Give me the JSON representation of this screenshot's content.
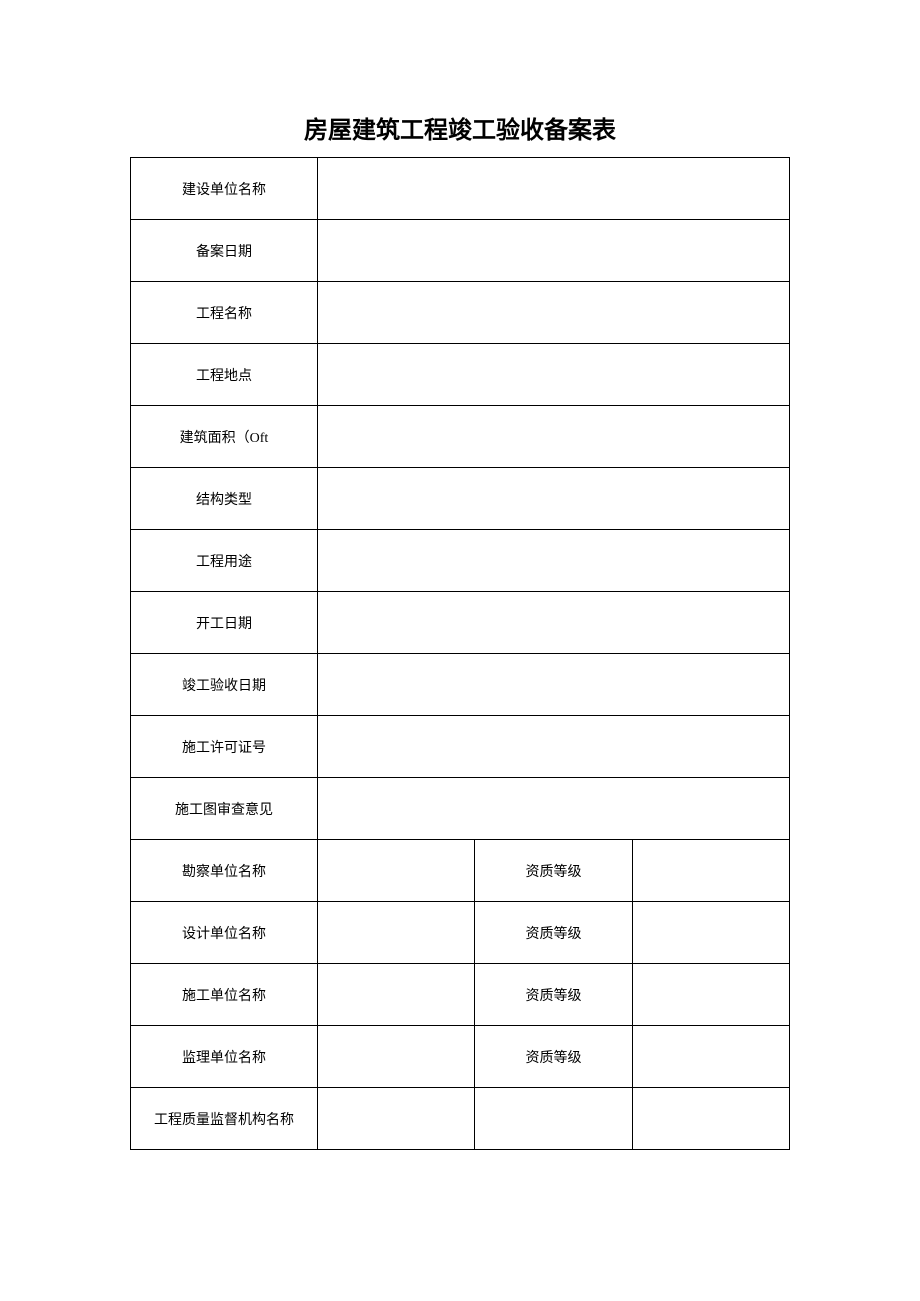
{
  "title": "房屋建筑工程竣工验收备案表",
  "rows_full": [
    {
      "label": "建设单位名称",
      "value": ""
    },
    {
      "label": "备案日期",
      "value": ""
    },
    {
      "label": "工程名称",
      "value": ""
    },
    {
      "label": "工程地点",
      "value": ""
    },
    {
      "label": "建筑面积（Oft",
      "value": ""
    },
    {
      "label": "结构类型",
      "value": ""
    },
    {
      "label": "工程用途",
      "value": ""
    },
    {
      "label": "开工日期",
      "value": ""
    },
    {
      "label": "竣工验收日期",
      "value": ""
    },
    {
      "label": "施工许可证号",
      "value": ""
    },
    {
      "label": "施工图审查意见",
      "value": ""
    }
  ],
  "rows_split": [
    {
      "label": "勘察单位名称",
      "value1": "",
      "sublabel": "资质等级",
      "value2": ""
    },
    {
      "label": "设计单位名称",
      "value1": "",
      "sublabel": "资质等级",
      "value2": ""
    },
    {
      "label": "施工单位名称",
      "value1": "",
      "sublabel": "资质等级",
      "value2": ""
    },
    {
      "label": "监理单位名称",
      "value1": "",
      "sublabel": "资质等级",
      "value2": ""
    },
    {
      "label": "工程质量监督机构名称",
      "value1": "",
      "sublabel": "",
      "value2": ""
    }
  ]
}
